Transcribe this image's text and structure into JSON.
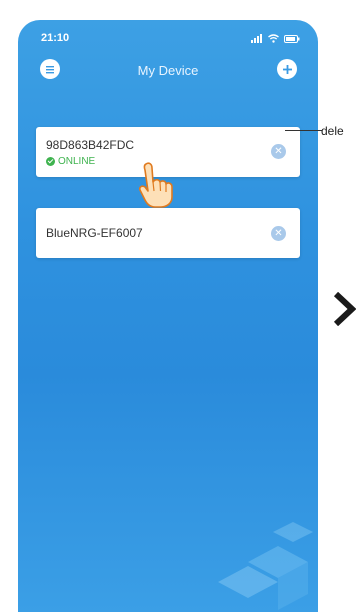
{
  "status_bar": {
    "time": "21:10"
  },
  "header": {
    "title": "My Device"
  },
  "devices": [
    {
      "name": "98D863B42FDC",
      "status": "ONLINE"
    },
    {
      "name": "BlueNRG-EF6007"
    }
  ],
  "callout": {
    "label": "dele"
  },
  "colors": {
    "background_top": "#3da0e4",
    "background_bottom": "#2a8bdb",
    "online": "#3fb34f",
    "delete_icon": "#a9c9ea"
  },
  "icons": [
    "menu-icon",
    "add-icon",
    "delete-icon",
    "check-icon",
    "pointing-hand-icon",
    "chevron-right-icon"
  ]
}
